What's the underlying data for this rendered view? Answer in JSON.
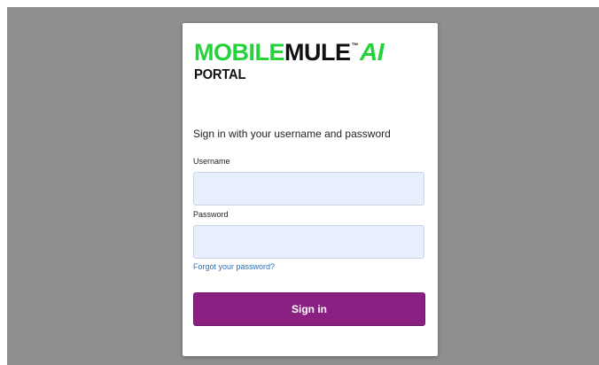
{
  "brand": {
    "name_green": "MOBILE",
    "name_black": "MULE",
    "trademark": "™",
    "suffix": "AI",
    "subtitle": "PORTAL",
    "colors": {
      "green": "#22d339",
      "black": "#111111"
    }
  },
  "login": {
    "heading": "Sign in with your username and password",
    "username_label": "Username",
    "username_value": "",
    "password_label": "Password",
    "password_value": "",
    "forgot_link": "Forgot your password?",
    "signin_button": "Sign in"
  },
  "colors": {
    "backdrop": "#8f8f8f",
    "input_background": "#e8effc",
    "button": "#8a2182",
    "link": "#2a6fb5"
  }
}
